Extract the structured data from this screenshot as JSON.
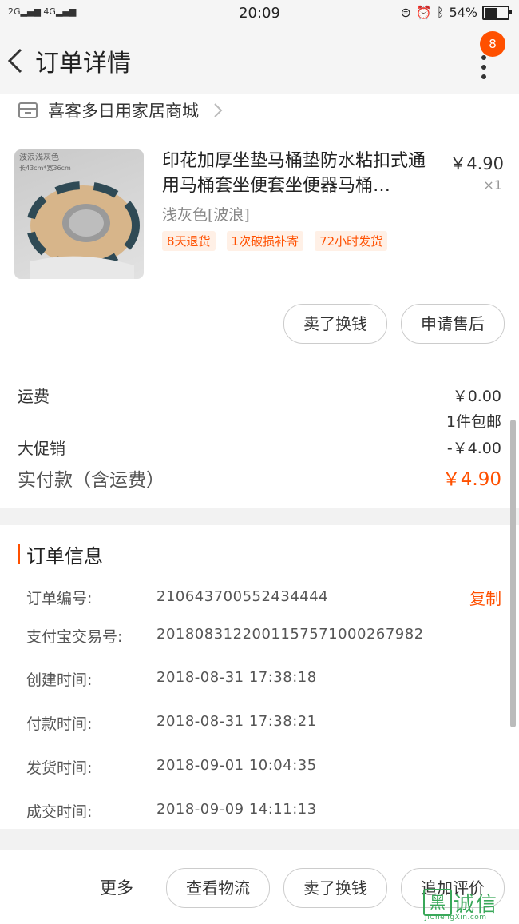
{
  "status_bar": {
    "signal_1": "2G",
    "signal_2": "4G",
    "time": "20:09",
    "battery": "54%",
    "battery_level_percent": 54
  },
  "nav": {
    "title": "订单详情",
    "badge_count": "8"
  },
  "shop": {
    "name": "喜客多日用家居商城"
  },
  "product": {
    "thumb_label_1": "波浪浅灰色",
    "thumb_label_2": "长43cm*宽36cm",
    "title": "印花加厚坐垫马桶垫防水粘扣式通用马桶套坐便套坐便器马桶…",
    "price": "￥4.90",
    "quantity": "×1",
    "sku": "浅灰色[波浪]",
    "tags": [
      "8天退货",
      "1次破损补寄",
      "72小时发货"
    ]
  },
  "item_actions": {
    "sell_label": "卖了换钱",
    "after_sale_label": "申请售后"
  },
  "fees": {
    "shipping_label": "运费",
    "shipping_value": "￥0.00",
    "shipping_note": "1件包邮",
    "promo_label": "大促销",
    "promo_value": "-￥4.00",
    "total_label": "实付款（含运费）",
    "total_value": "￥4.90"
  },
  "order_info": {
    "title": "订单信息",
    "copy_label": "复制",
    "rows": [
      {
        "label": "订单编号:",
        "value": "210643700552434444"
      },
      {
        "label": "支付宝交易号:",
        "value": "2018083122001157571000267982"
      },
      {
        "label": "创建时间:",
        "value": "2018-08-31 17:38:18"
      },
      {
        "label": "付款时间:",
        "value": "2018-08-31 17:38:21"
      },
      {
        "label": "发货时间:",
        "value": "2018-09-01 10:04:35"
      },
      {
        "label": "成交时间:",
        "value": "2018-09-09 14:11:13"
      }
    ]
  },
  "bottom_bar": {
    "more_label": "更多",
    "logistics_label": "查看物流",
    "sell_label": "卖了换钱",
    "review_label": "追加评价"
  },
  "watermark": {
    "box_char": "黑",
    "text": "诚信",
    "sub": "JiChengXin.com"
  },
  "colors": {
    "accent": "#ff5000",
    "tag_bg": "#fff0e6"
  }
}
